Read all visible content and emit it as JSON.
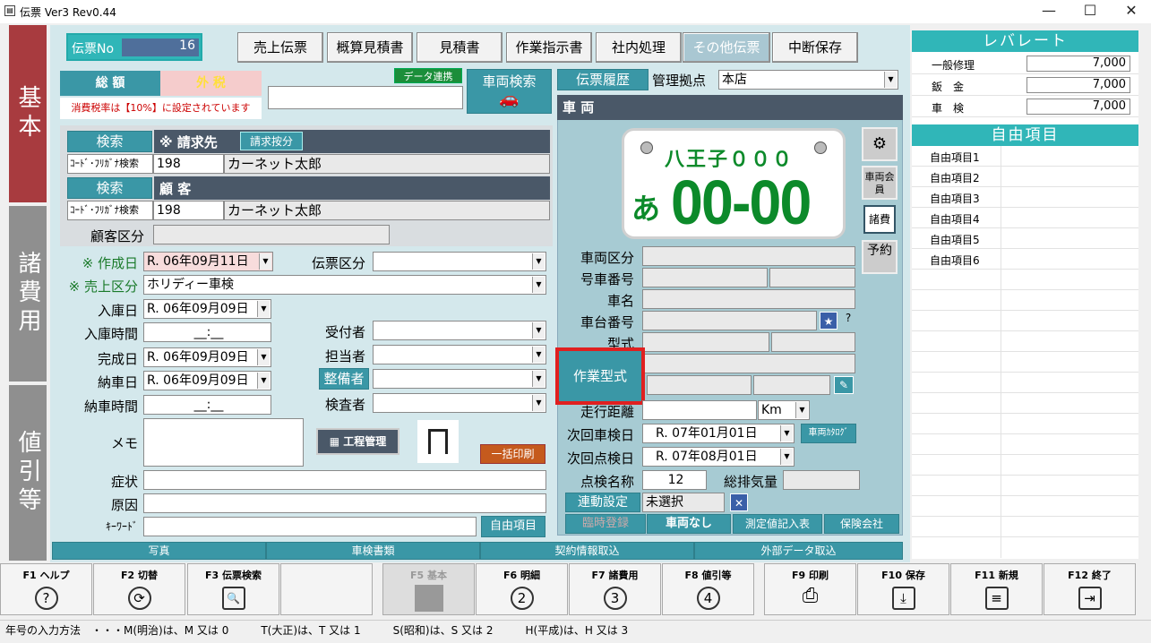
{
  "window": {
    "title": "伝票 Ver3 Rev0.44",
    "icon": "document-icon"
  },
  "sidetabs": [
    {
      "label": "基本",
      "color": "#a83b3f"
    },
    {
      "label": "諸費用",
      "color": "#8f8f8f"
    },
    {
      "label": "値引等",
      "color": "#8f8f8f"
    }
  ],
  "slip": {
    "no_label": "伝票No",
    "no_value": "16"
  },
  "toptabs": [
    "売上伝票",
    "概算見積書",
    "見積書",
    "作業指示書",
    "社内処理",
    "その他伝票",
    "中断保存"
  ],
  "totals": {
    "total_label": "総 額",
    "tax_label": "外 税",
    "data_link": "データ連携",
    "tax_note": "消費税率は【10%】に設定されています"
  },
  "vehicle_search": "車両検索",
  "history": {
    "label": "伝票履歴",
    "base_label": "管理拠点",
    "base_value": "本店"
  },
  "billing": {
    "search": "検索",
    "title": "※ 請求先",
    "split": "請求按分",
    "code_label": "ｺｰﾄﾞ･ﾌﾘｶﾞﾅ検索",
    "code": "198",
    "name": "カーネット太郎"
  },
  "customer": {
    "search": "検索",
    "title": "顧 客",
    "code_label": "ｺｰﾄﾞ･ﾌﾘｶﾞﾅ検索",
    "code": "198",
    "name": "カーネット太郎",
    "class_label": "顧客区分"
  },
  "form": {
    "created_label": "※ 作成日",
    "created": "R. 06年09月11日",
    "slip_type_label": "伝票区分",
    "sales_type_label": "※ 売上区分",
    "sales_type": "ホリディー車検",
    "in_date_label": "入庫日",
    "in_date": "R. 06年09月09日",
    "in_time_label": "入庫時間",
    "in_time": "__:__",
    "receiver_label": "受付者",
    "done_label": "完成日",
    "done_date": "R. 06年09月09日",
    "staff_label": "担当者",
    "deliv_label": "納車日",
    "deliv_date": "R. 06年09月09日",
    "mech_label": "整備者",
    "deliv_time_label": "納車時間",
    "deliv_time": "__:__",
    "inspector_label": "検査者",
    "memo_label": "メモ",
    "schedule_btn": "工程管理",
    "batch_print": "一括印刷",
    "symptom_label": "症状",
    "cause_label": "原因",
    "keyword_label": "ｷｰﾜｰﾄﾞ",
    "free_btn": "自由項目"
  },
  "vehicle": {
    "header": "車 両",
    "plate_top": "八王子０００",
    "plate_kana": "あ",
    "plate_num": "00-00",
    "side_icons": [
      "car-icon",
      "車両会員",
      "諸費",
      "予約"
    ],
    "labels": {
      "class": "車両区分",
      "num": "号車番号",
      "name": "車名",
      "chassis": "車台番号",
      "model": "型式",
      "work_model": "作業型式",
      "mileage": "走行距離",
      "next_inspect": "次回車検日",
      "next_check": "次回点検日",
      "check_name": "点検名称",
      "displacement": "総排気量",
      "link": "連動設定"
    },
    "mileage_unit": "Km",
    "next_inspect": "R. 07年01月01日",
    "catalog_btn": "車両ｶﾀﾛｸﾞ",
    "next_check": "R. 07年08月01日",
    "check_name": "12",
    "link_value": "未選択",
    "bottom_btns": [
      "臨時登録",
      "車両なし",
      "測定値記入表",
      "保険会社"
    ]
  },
  "bottom_bar": [
    "写真",
    "車検書類",
    "契約情報取込",
    "外部データ取込"
  ],
  "lever": {
    "title": "レバレート",
    "rows": [
      {
        "label": "一般修理",
        "value": "7,000"
      },
      {
        "label": "鈑　金",
        "value": "7,000"
      },
      {
        "label": "車　検",
        "value": "7,000"
      }
    ]
  },
  "free_items": {
    "title": "自由項目",
    "rows": [
      "自由項目1",
      "自由項目2",
      "自由項目3",
      "自由項目4",
      "自由項目5",
      "自由項目6"
    ]
  },
  "fkeys": [
    {
      "key": "F1 ヘルプ",
      "icon": "?"
    },
    {
      "key": "F2 切替",
      "icon": "⟳"
    },
    {
      "key": "F3 伝票検索",
      "icon": "🔍"
    },
    {
      "key": "",
      "icon": ""
    },
    {
      "key": "F5 基本",
      "icon": ""
    },
    {
      "key": "F6 明細",
      "icon": "2"
    },
    {
      "key": "F7 諸費用",
      "icon": "3"
    },
    {
      "key": "F8 値引等",
      "icon": "4"
    },
    {
      "key": "F9 印刷",
      "icon": "⎙"
    },
    {
      "key": "F10 保存",
      "icon": "⤓"
    },
    {
      "key": "F11 新規",
      "icon": "≡"
    },
    {
      "key": "F12 終了",
      "icon": "⇥"
    }
  ],
  "status": "年号の入力方法　・・・M(明治)は、M 又は 0　　　T(大正)は、T 又は 1　　　S(昭和)は、S 又は 2　　　H(平成)は、H 又は 3"
}
